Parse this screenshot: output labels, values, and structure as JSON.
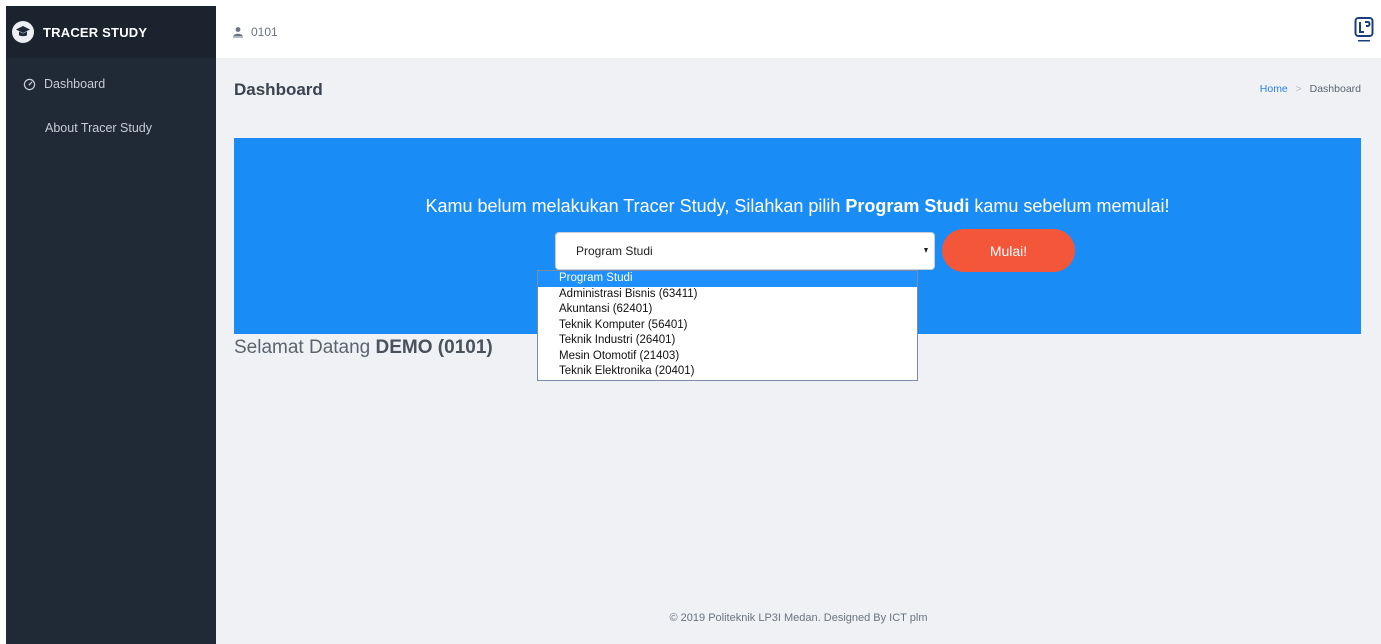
{
  "sidebar": {
    "brand_title": "TRACER STUDY",
    "items": [
      {
        "label": "Dashboard",
        "icon": "dashboard-gauge-icon"
      },
      {
        "label": "About Tracer Study"
      }
    ]
  },
  "topbar": {
    "user_id": "0101",
    "user_icon": "user-icon",
    "logo_icon": "lp3i-logo-icon"
  },
  "page": {
    "title": "Dashboard",
    "breadcrumb": {
      "home": "Home",
      "separator": ">",
      "current": "Dashboard"
    }
  },
  "banner": {
    "text_before": "Kamu belum melakukan Tracer Study, Silahkan pilih ",
    "text_bold": "Program Studi",
    "text_after": " kamu sebelum memulai!",
    "select_value": "Program Studi",
    "start_label": "Mulai!"
  },
  "dropdown": {
    "options": [
      "Program Studi",
      "Administrasi Bisnis (63411)",
      "Akuntansi (62401)",
      "Teknik Komputer (56401)",
      "Teknik Industri (26401)",
      "Mesin Otomotif (21403)",
      "Teknik Elektronika (20401)"
    ],
    "selected_index": 0
  },
  "welcome": {
    "prefix": "Selamat Datang ",
    "name": "DEMO (0101)"
  },
  "footer": {
    "text": "© 2019 Politeknik LP3I Medan. Designed By ICT plm"
  },
  "colors": {
    "sidebar_bg": "#202a37",
    "banner_bg": "#1a8cf5",
    "start_button": "#f4563a",
    "selected_option": "#1e90ff",
    "link": "#2b81e8"
  }
}
